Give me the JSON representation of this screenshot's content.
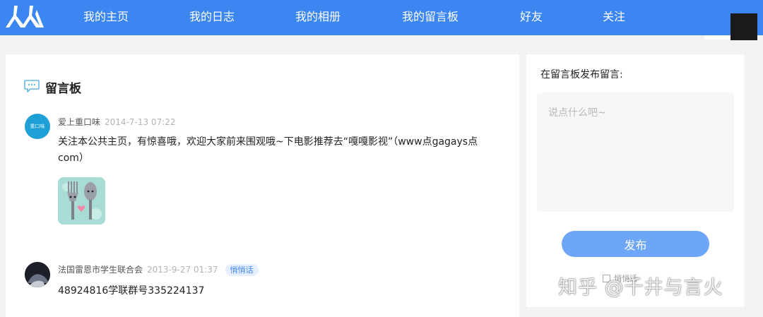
{
  "nav": {
    "items": [
      {
        "label": "我的主页"
      },
      {
        "label": "我的日志"
      },
      {
        "label": "我的相册"
      },
      {
        "label": "我的留言板"
      },
      {
        "label": "好友"
      },
      {
        "label": "关注"
      }
    ]
  },
  "board": {
    "title": "留言板"
  },
  "messages": [
    {
      "author": "爱上重口味",
      "avatar_text": "重口味",
      "time": "2014-7-13 07:22",
      "text": "关注本公共主页，有惊喜哦，欢迎大家前来围观哦~下电影推荐去“嘎嘎影视”（www点gagays点com）",
      "has_image": true
    },
    {
      "author": "法国雷恩市学生联合会",
      "time": "2013-9-27 01:37",
      "tag": "悄悄话",
      "text": "48924816学联群号335224137"
    }
  ],
  "post": {
    "label": "在留言板发布留言:",
    "placeholder": "说点什么吧~",
    "button": "发布",
    "whisper_label": "悄悄话"
  },
  "watermark": "知乎 @千井与言火",
  "colors": {
    "nav_bg": "#3b86f0",
    "button": "#6ea6f7",
    "badge_bg": "#e5efff"
  }
}
